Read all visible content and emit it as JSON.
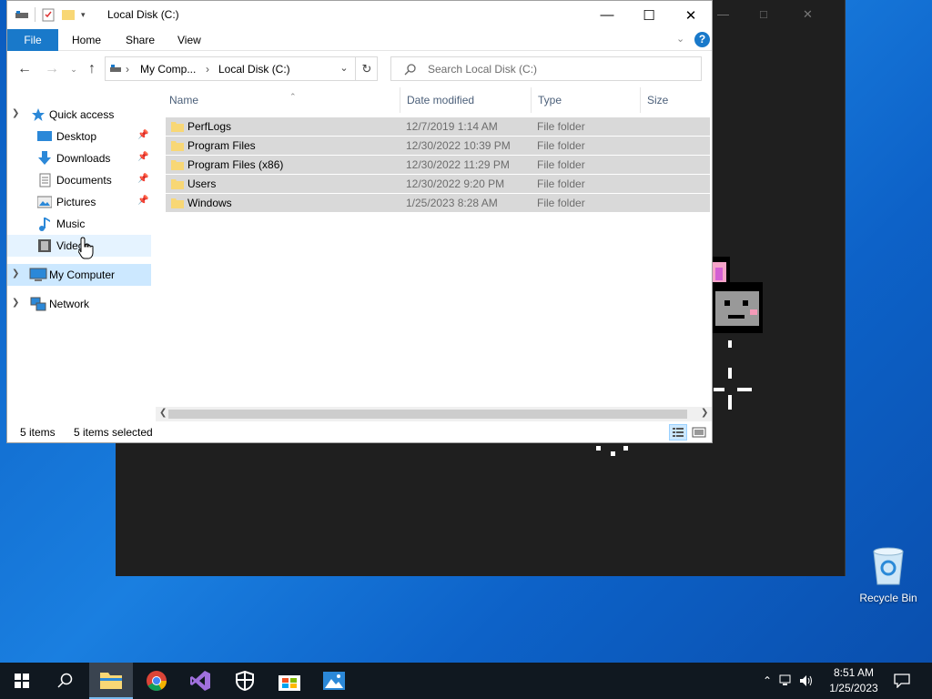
{
  "window": {
    "title": "Local Disk (C:)"
  },
  "ribbon": {
    "tabs": [
      "File",
      "Home",
      "Share",
      "View"
    ]
  },
  "address": {
    "segments": [
      "My Comp...",
      "Local Disk (C:)"
    ]
  },
  "search": {
    "placeholder": "Search Local Disk (C:)"
  },
  "nav": {
    "quick_access": "Quick access",
    "items": [
      {
        "label": "Desktop",
        "icon": "desktop-icon",
        "pinned": true
      },
      {
        "label": "Downloads",
        "icon": "downloads-icon",
        "pinned": true
      },
      {
        "label": "Documents",
        "icon": "documents-icon",
        "pinned": true
      },
      {
        "label": "Pictures",
        "icon": "pictures-icon",
        "pinned": true
      },
      {
        "label": "Music",
        "icon": "music-icon",
        "pinned": false
      },
      {
        "label": "Videos",
        "icon": "videos-icon",
        "pinned": false
      }
    ],
    "my_computer": "My Computer",
    "network": "Network"
  },
  "columns": {
    "name": "Name",
    "date": "Date modified",
    "type": "Type",
    "size": "Size"
  },
  "files": [
    {
      "name": "PerfLogs",
      "date": "12/7/2019 1:14 AM",
      "type": "File folder"
    },
    {
      "name": "Program Files",
      "date": "12/30/2022 10:39 PM",
      "type": "File folder"
    },
    {
      "name": "Program Files (x86)",
      "date": "12/30/2022 11:29 PM",
      "type": "File folder"
    },
    {
      "name": "Users",
      "date": "12/30/2022 9:20 PM",
      "type": "File folder"
    },
    {
      "name": "Windows",
      "date": "1/25/2023 8:28 AM",
      "type": "File folder"
    }
  ],
  "status": {
    "count": "5 items",
    "selected": "5 items selected"
  },
  "desktop": {
    "recycle_bin": "Recycle Bin"
  },
  "taskbar": {
    "apps": [
      "start-icon",
      "search-icon",
      "file-explorer-icon",
      "chrome-icon",
      "visual-studio-icon",
      "security-icon",
      "store-icon",
      "photos-icon"
    ],
    "time": "8:51 AM",
    "date": "1/25/2023"
  },
  "colors": {
    "accent": "#1979ca",
    "selection": "#d9d9d9",
    "taskbar": "#101820"
  }
}
